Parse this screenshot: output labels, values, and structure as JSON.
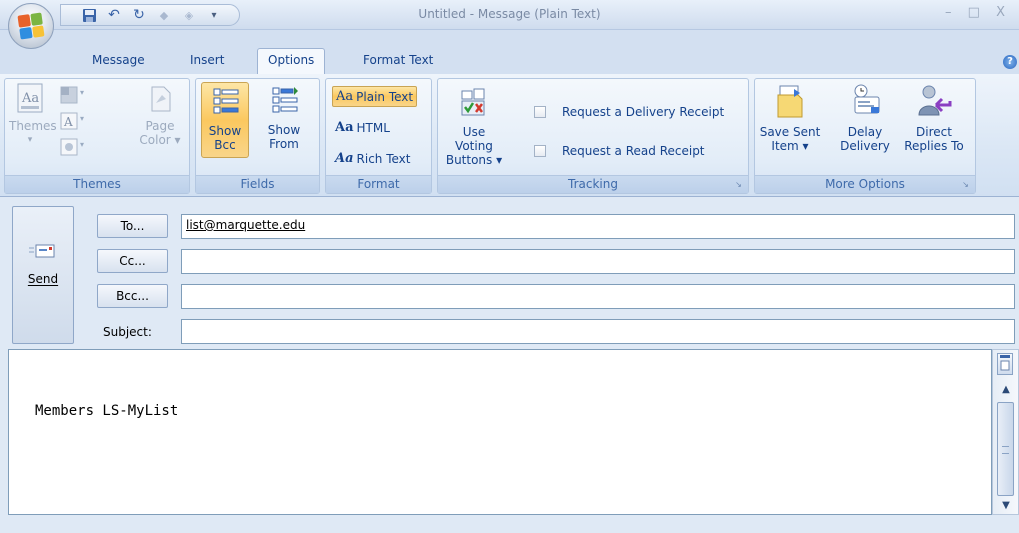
{
  "window": {
    "title": "Untitled - Message (Plain Text)",
    "controls": "– □ X"
  },
  "tabs": [
    {
      "label": "Message"
    },
    {
      "label": "Insert"
    },
    {
      "label": "Options"
    },
    {
      "label": "Format Text"
    }
  ],
  "ribbon": {
    "themes": {
      "group_label": "Themes",
      "themes_label": "Themes",
      "page_color_label_1": "Page",
      "page_color_label_2": "Color ▾"
    },
    "fields": {
      "group_label": "Fields",
      "show_bcc_1": "Show",
      "show_bcc_2": "Bcc",
      "show_from_1": "Show",
      "show_from_2": "From"
    },
    "format": {
      "group_label": "Format",
      "plain_text": "Plain Text",
      "html": "HTML",
      "rich_text": "Rich Text"
    },
    "tracking": {
      "group_label": "Tracking",
      "voting_1": "Use Voting",
      "voting_2": "Buttons ▾",
      "delivery_receipt": "Request a Delivery Receipt",
      "read_receipt": "Request a Read Receipt"
    },
    "more_options": {
      "group_label": "More Options",
      "save_sent_1": "Save Sent",
      "save_sent_2": "Item ▾",
      "delay_1": "Delay",
      "delay_2": "Delivery",
      "direct_1": "Direct",
      "direct_2": "Replies To"
    }
  },
  "header": {
    "send_label": "Send",
    "to_button": "To...",
    "cc_button": "Cc...",
    "bcc_button": "Bcc...",
    "subject_label": "Subject:",
    "to_value": "list@marquette.edu",
    "cc_value": "",
    "bcc_value": "",
    "subject_value": ""
  },
  "body": {
    "text": "Members LS-MyList"
  },
  "colors": {
    "accent": "#15428b",
    "ribbon_bg": "#dbe7f5",
    "pressed": "#fbc85f"
  }
}
